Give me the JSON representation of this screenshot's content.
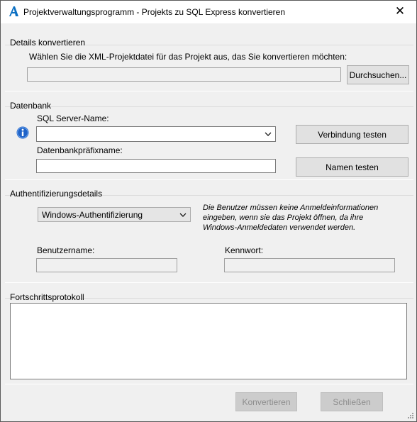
{
  "window": {
    "title": "Projektverwaltungsprogramm - Projekts zu SQL Express konvertieren",
    "close_glyph": "✕",
    "app_icon": "autodesk-a-icon"
  },
  "details": {
    "title": "Details konvertieren",
    "instruction": "Wählen Sie die XML-Projektdatei für das Projekt aus, das Sie konvertieren möchten:",
    "path_value": "",
    "browse_label": "Durchsuchen..."
  },
  "database": {
    "title": "Datenbank",
    "server_label": "SQL Server-Name:",
    "server_value": "",
    "prefix_label": "Datenbankpräfixname:",
    "prefix_value": "",
    "test_connection_label": "Verbindung testen",
    "test_names_label": "Namen testen",
    "info_icon": "info-icon"
  },
  "auth": {
    "title": "Authentifizierungsdetails",
    "mode_selected": "Windows-Authentifizierung",
    "note": "Die Benutzer müssen keine Anmeldeinformationen eingeben, wenn  sie das Projekt öffnen, da ihre Windows-Anmeldedaten verwendet werden.",
    "username_label": "Benutzername:",
    "username_value": "",
    "password_label": "Kennwort:",
    "password_value": ""
  },
  "progress": {
    "title": "Fortschrittsprotokoll",
    "log_text": ""
  },
  "footer": {
    "convert_label": "Konvertieren",
    "close_label": "Schließen"
  },
  "colors": {
    "window_bg": "#f0f0f0",
    "titlebar_bg": "#ffffff",
    "button_bg": "#e1e1e1",
    "info_blue": "#1f63c8",
    "disabled_text": "#8d8d8d"
  }
}
